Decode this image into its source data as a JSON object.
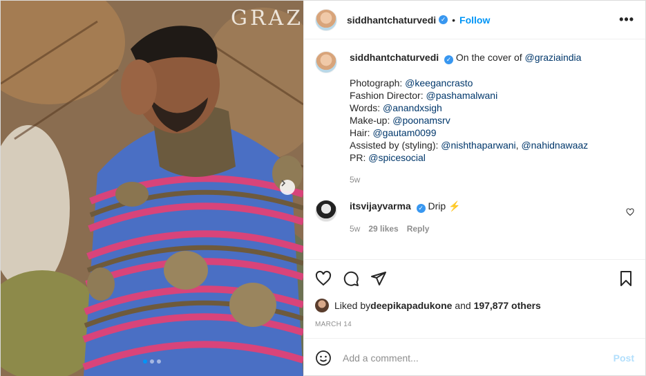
{
  "photo": {
    "magazine_title": "GRAZIA",
    "carousel": {
      "count": 3,
      "active": 0
    }
  },
  "post": {
    "username": "siddhantchaturvedi",
    "follow_label": "Follow",
    "more_label": "•••",
    "dot_separator": "•"
  },
  "caption": {
    "username": "siddhantchaturvedi",
    "text": "On the cover of ",
    "mention": "@graziaindia",
    "credits": [
      {
        "label": "Photograph: ",
        "handles": [
          "@keegancrasto"
        ]
      },
      {
        "label": "Fashion Director: ",
        "handles": [
          "@pashamalwani"
        ]
      },
      {
        "label": "Words: ",
        "handles": [
          "@anandxsigh"
        ]
      },
      {
        "label": "Make-up: ",
        "handles": [
          "@poonamsrv"
        ]
      },
      {
        "label": "Hair: ",
        "handles": [
          "@gautam0099"
        ]
      },
      {
        "label": "Assisted by (styling): ",
        "handles": [
          "@nishthaparwani",
          "@nahidnawaaz"
        ]
      },
      {
        "label": "PR: ",
        "handles": [
          "@spicesocial"
        ]
      }
    ],
    "time": "5w"
  },
  "comment": {
    "username": "itsvijayvarma",
    "text": "Drip",
    "emoji": "⚡",
    "time": "5w",
    "likes": "29 likes",
    "reply_label": "Reply"
  },
  "likes": {
    "prefix": "Liked by ",
    "user": "deepikapadukone",
    "mid": " and ",
    "count": "197,877 others"
  },
  "date": "MARCH 14",
  "add_comment": {
    "placeholder": "Add a comment...",
    "post_label": "Post"
  },
  "colors": {
    "link": "#0095f6",
    "mention": "#00376b",
    "muted": "#8e8e8e"
  }
}
